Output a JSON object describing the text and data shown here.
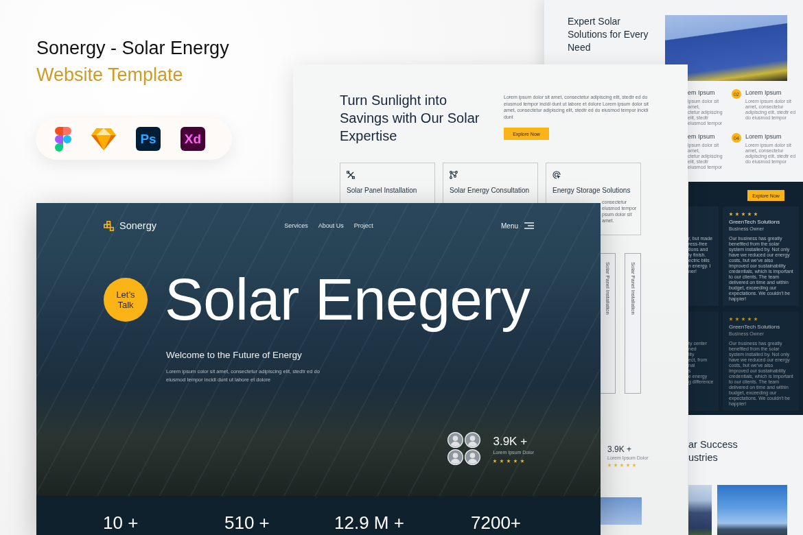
{
  "promo": {
    "title": "Sonergy - Solar Energy",
    "subtitle": "Website Template",
    "tools": [
      {
        "kind": "figma"
      },
      {
        "kind": "sketch"
      },
      {
        "kind": "photoshop",
        "label": "Ps"
      },
      {
        "kind": "xd",
        "label": "Xd"
      }
    ]
  },
  "back_page": {
    "heading": "Expert Solar Solutions for Every Need",
    "features": [
      {
        "kind": "partial",
        "title": "em Ipsum",
        "lines": [
          "ipsum dolor sit amet,",
          "ctetur adipiscing elit, stedtr",
          "eiusmod tempor"
        ]
      },
      {
        "kind": "full",
        "number": "02",
        "title": "Lorem Ipsum",
        "text": "Lorem ipsum dolor sit amet, consectetur adipiscing elit, stedtr ed do eiusmod tempor"
      },
      {
        "kind": "partial",
        "title": "em Ipsum",
        "lines": [
          "ipsum dolor sit amet,",
          "ctetur adipiscing elit, stedtr",
          "eiusmod tempor"
        ]
      },
      {
        "kind": "full",
        "number": "04",
        "title": "Lorem Ipsum",
        "text": "Lorem ipsum dolor sit amet, consectetur adipiscing elit, stedtr ed do eiusmod tempor"
      }
    ],
    "cta": "Explore Now",
    "testimonials": [
      {
        "kind": "partial",
        "faded": false,
        "lines": [
          "r, but made",
          "ress-free",
          "tions and",
          "ly finish.",
          "ectric bills",
          "n energy. I",
          "ner!"
        ]
      },
      {
        "kind": "full",
        "faded": false,
        "stars": 5,
        "name": "GreenTech Solutions",
        "role": "Business Owner",
        "text": "Our business has greatly benefited from the solar system installed by. Not only have we reduced our energy costs, but we've also improved our sustainability credentials, which is important to our clients. The team delivered on time and within budget, exceeding our expectations. We couldn't be happier!"
      },
      {
        "kind": "partial",
        "faded": true,
        "lines": [
          "ty center",
          "ned",
          "lity",
          "ect, from",
          "nal",
          "s",
          "e energy",
          "g difference"
        ]
      },
      {
        "kind": "full",
        "faded": true,
        "stars": 5,
        "name": "GreenTech Solutions",
        "role": "Business Owner",
        "text": "Our business has greatly benefited from the solar system installed by. Not only have we reduced our energy costs, but we've also improved our sustainability credentials, which is important to our clients. The team delivered on time and within budget, exceeding our expectations. We couldn't be happier!"
      }
    ],
    "success_heading": [
      "ar Success",
      "ustries"
    ]
  },
  "middle_page": {
    "heading": "Turn Sunlight into Savings with Our Solar Expertise",
    "text": "Lorem ipsum dolor sit amet, consectetur adipiscing elit, stedtr ed do eiusmod tempor incidi dunt ut labore et dolore Lorem ipsum dolor sit amet, consectetur adipiscing elit, stedtr ed do eiusmod tempor incidi dunt",
    "cta": "Explore Now",
    "services": [
      {
        "title": "Solar Panel Installation"
      },
      {
        "title": "Solar Energy Consultation"
      },
      {
        "title": "Energy Storage Solutions",
        "lines": [
          "consectetur",
          "eiusmod tempor",
          "psum dolor sit amet."
        ]
      }
    ],
    "collapsed_services": [
      "Solar Panel Installation",
      "Solar Panel Installation"
    ],
    "reviews": {
      "count": "3.9K +",
      "label": "Lorem Ipsum Dolor",
      "stars": 5
    }
  },
  "hero": {
    "brand": "Sonergy",
    "nav": [
      "Services",
      "About Us",
      "Project"
    ],
    "menu": "Menu",
    "cta": "Let’s Talk",
    "title": "Solar Enegery",
    "subtitle": "Welcome to the Future of Energy",
    "text": "Lorem ipsum color sit amet, consectetur adipiscing elit, stedtr ed do eiusmod tempor incidi dunt ut labore et dolore",
    "reviews": {
      "count": "3.9K +",
      "label": "Lorem Ipsum Dolor",
      "stars": 5
    },
    "stats": [
      "10 +",
      "510 +",
      "12.9 M +",
      "7200+"
    ]
  }
}
